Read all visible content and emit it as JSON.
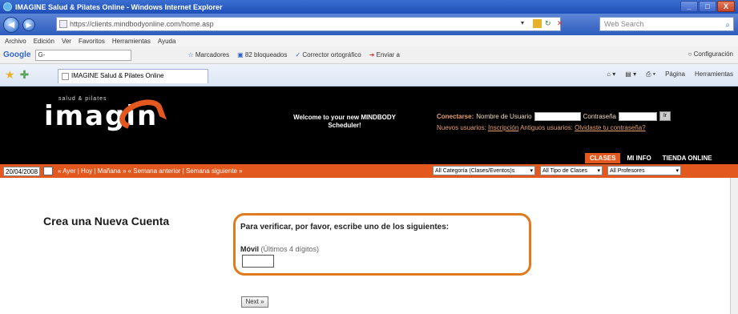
{
  "window": {
    "title": "IMAGINE Salud & Pilates Online - Windows Internet Explorer",
    "controls": [
      "_",
      "□",
      "X"
    ]
  },
  "address": {
    "url": "https://clients.mindbodyonline.com/home.asp",
    "search_placeholder": "Web Search"
  },
  "menu": [
    "Archivo",
    "Edición",
    "Ver",
    "Favoritos",
    "Herramientas",
    "Ayuda"
  ],
  "google_toolbar": {
    "logo": "Google",
    "search_value": "G-",
    "items": [
      "Marcadores",
      "82 bloqueados",
      "Corrector ortográfico",
      "Enviar a"
    ],
    "config": "Configuración"
  },
  "tab": {
    "label": "IMAGINE Salud & Pilates Online"
  },
  "command_bar": [
    "Página",
    "Herramientas"
  ],
  "site": {
    "logo_tag": "salud & pilates",
    "logo_word": "imagin",
    "welcome": "Welcome to your new MINDBODY Scheduler!",
    "login": {
      "label": "Conectarse:",
      "user_label": "Nombre de Usuario",
      "password_label": "Contraseña",
      "go": "Ir",
      "new_users": "Nuevos usuarios:",
      "signup": "Inscripción",
      "old_users": "Antiguos usuarios:",
      "forgot": "Olvidaste tu contraseña?"
    },
    "tabs": [
      "CLASES",
      "MI INFO",
      "TIENDA ONLINE"
    ]
  },
  "schedule_bar": {
    "date": "20/04/2008",
    "nav": "« Ayer | Hoy | Mañana » « Semana anterior | Semana siguiente »",
    "filters": [
      "All Categoría (Clases/Eventos)s",
      "All Tipo de Clases",
      "All Profesores"
    ]
  },
  "form": {
    "title": "Crea una Nueva Cuenta",
    "prompt": "Para verificar, por favor, escribe uno de los siguientes:",
    "mobile_label": "Móvil",
    "mobile_hint": "(Últimos 4 dígitos)",
    "next": "Next »"
  },
  "colors": {
    "accent": "#e2581f",
    "highlight": "#e07a1c",
    "header_bg": "#000000"
  }
}
